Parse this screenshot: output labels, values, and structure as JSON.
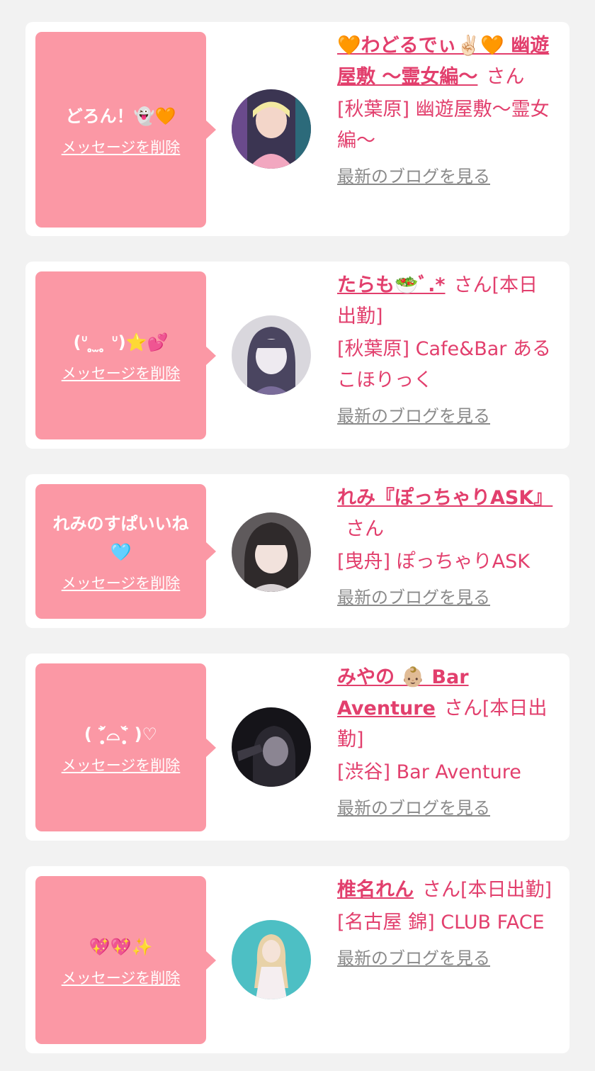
{
  "colors": {
    "background": "#f2f2f2",
    "card": "#ffffff",
    "bubble": "#fb98a5",
    "accent": "#e23f6d",
    "link_gray": "#8a8a8a"
  },
  "cards": [
    {
      "message": "どろん！👻🧡",
      "delete_label": "メッセージを削除",
      "name": "🧡わどるでぃ✌🏻🧡 幽遊屋敷 〜霊女編〜",
      "honorific": "さん",
      "shop": "[秋葉原] 幽遊屋敷〜霊女編〜",
      "blog_label": "最新のブログを見る",
      "avatar_colors": [
        "#3b3552",
        "#f3d6c9"
      ]
    },
    {
      "message": "(ᐡ ̥̥̥  ̫ ̥̥̥ ᐡ)⭐💕",
      "delete_label": "メッセージを削除",
      "name": "たらも🥗ﾞ.*",
      "honorific": "さん[本日出勤]",
      "shop": "[秋葉原] Cafe&Bar あるこほりっく",
      "blog_label": "最新のブログを見る",
      "avatar_colors": [
        "#6b6d87",
        "#eeeaf0"
      ]
    },
    {
      "message": "れみのすぱいいね\n🩵",
      "delete_label": "メッセージを削除",
      "name": "れみ『ぽっちゃりASK』",
      "honorific": "さん",
      "shop": "[曳舟] ぽっちゃりASK",
      "blog_label": "最新のブログを見る",
      "avatar_colors": [
        "#3a3536",
        "#f2e2dc"
      ]
    },
    {
      "message": "( ˃̣̣̥᷄⌓˂̣̣̥᷅ )♡",
      "delete_label": "メッセージを削除",
      "name": "みやの 👶🏼 Bar Aventure",
      "honorific": "さん[本日出勤]",
      "shop": "[渋谷] Bar Aventure",
      "blog_label": "最新のブログを見る",
      "avatar_colors": [
        "#151419",
        "#8b8592"
      ]
    },
    {
      "message": "💖💖✨",
      "delete_label": "メッセージを削除",
      "name": "椎名れん",
      "honorific": "さん[本日出勤]",
      "shop": "[名古屋 錦] CLUB FACE",
      "blog_label": "最新のブログを見る",
      "avatar_colors": [
        "#4dbfc4",
        "#f5eef0"
      ]
    }
  ]
}
